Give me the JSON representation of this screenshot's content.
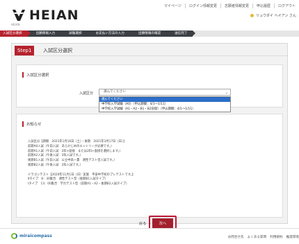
{
  "header": {
    "logo_text": "HEIAN",
    "logo_sub": "HEIAN",
    "links": [
      "マイページ",
      "ログイン情報変更",
      "志願者情報変更",
      "申込履歴",
      "ログアウト"
    ],
    "user_name": "リュウダイ ヘイアン さん"
  },
  "steps": [
    "入試区分選択",
    "出願情報入力",
    "試験選択",
    "お支払い方法の入力",
    "出願情報の確認",
    "送信完了"
  ],
  "step_title": {
    "badge": "Step1",
    "name": "入試区分選択"
  },
  "exam_select": {
    "heading": "入試区分選択",
    "label": "入試区分",
    "selected": "選んでください",
    "options": [
      "選んでください",
      "中学校入学試験（A0）（申込期間：4/1〜1/11）",
      "中学校入学試験（A1・A2・B1・B2日程）（申込期間：4/1〜1/11）"
    ]
  },
  "notice": {
    "heading": "お知らせ",
    "lines": [
      "入試区分【期間　2021年1月16日（土）・後期　2021年3月17日（日）】",
      "前期A0入試（午前入試　あらかじめのエントリーが必要です。）",
      "前期A1入試（午前入試　2科+面接　または2科+面接を選択します。）",
      "前期A2入試（午後入試　2科入試です。）",
      "後期B1入試（午前入試　公立中高一貫　適性テスト型入試です。）",
      "後期B2入試（午後入試　2科入試です。）",
      "",
      "ドラゴンテスト【2020年11月1日（日）実施　平安中学校のプレテストです。】",
      "Ⅱタイプ　8：30集合　適性テスト型（後期B1入試タイプ）",
      "Ⅰタイプ　13：00集合　学力テスト型（前期A1・A2・後期B2入試タイプ）"
    ]
  },
  "buttons": {
    "back": "戻る",
    "next": "次へ"
  },
  "footer": {
    "brand": "miraicompass",
    "links": [
      "お問合せ先",
      "よくある質問",
      "利用規約",
      "推奨環境"
    ]
  },
  "colors": {
    "accent": "#b6222e",
    "next_button": "#a31f2d",
    "highlight_frame": "#c01a3a",
    "step_inactive": "#3b3f44"
  }
}
